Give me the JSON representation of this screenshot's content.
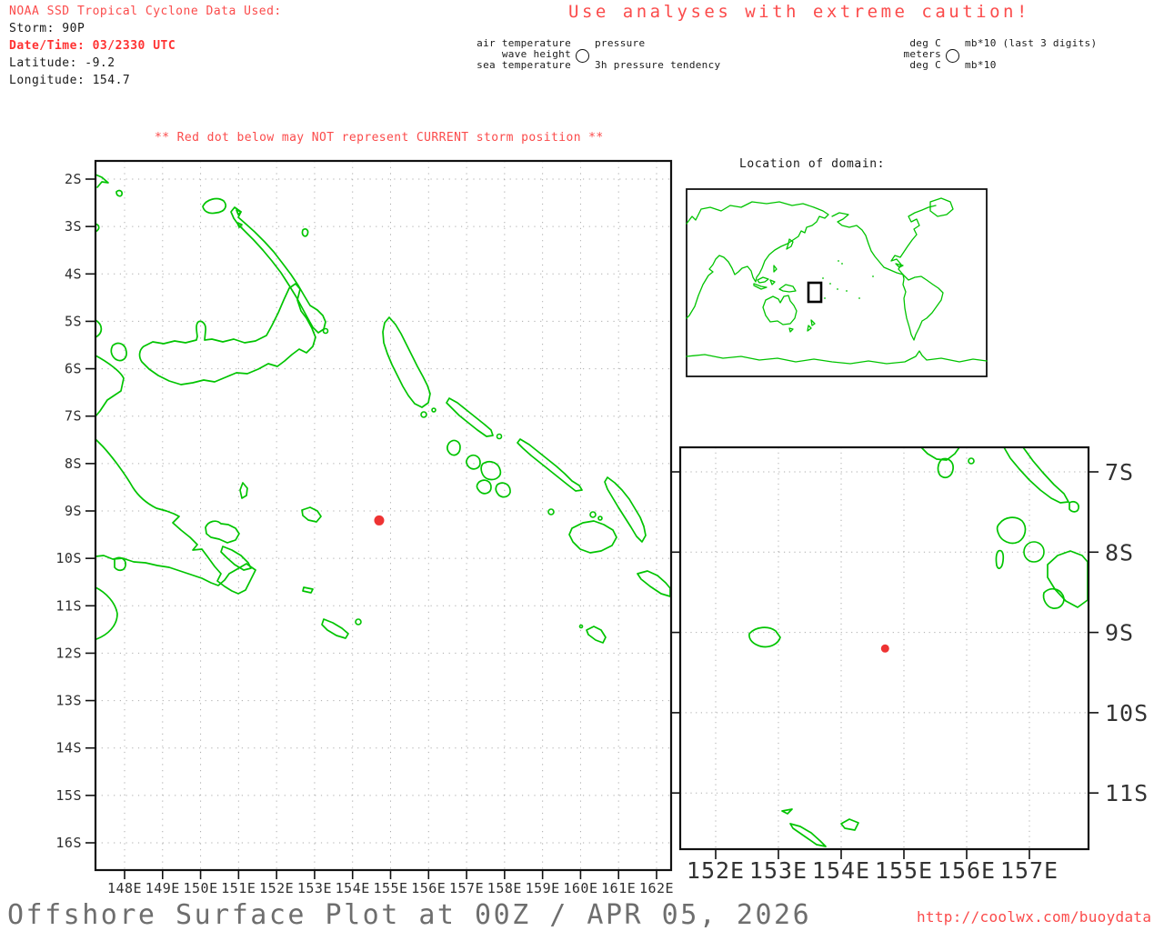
{
  "header": {
    "source_line": "NOAA SSD Tropical Cyclone Data Used:",
    "storm_line": "Storm: 90P",
    "datetime_line": "Date/Time: 03/2330 UTC",
    "latitude_line": "Latitude: -9.2",
    "longitude_line": "Longitude: 154.7",
    "caution": "Use analyses with extreme caution!"
  },
  "station_legend": {
    "param_left": [
      "air temperature",
      "wave height",
      "sea temperature"
    ],
    "param_right_top": "pressure",
    "param_right_bottom": "3h pressure tendency",
    "unit_left": [
      "deg C",
      "meters",
      "deg C"
    ],
    "unit_right_top": "mb*10 (last 3 digits)",
    "unit_right_bottom": "mb*10",
    "circle_icon": "station-circle"
  },
  "warning": "** Red dot below may NOT represent CURRENT storm position **",
  "main_map": {
    "lon_labels": [
      "148E",
      "149E",
      "150E",
      "151E",
      "152E",
      "153E",
      "154E",
      "155E",
      "156E",
      "157E",
      "158E",
      "159E",
      "160E",
      "161E",
      "162E"
    ],
    "lat_labels": [
      "2S",
      "3S",
      "4S",
      "5S",
      "6S",
      "7S",
      "8S",
      "9S",
      "10S",
      "11S",
      "12S",
      "13S",
      "14S",
      "15S",
      "16S"
    ]
  },
  "inset": {
    "title": "Location of domain:"
  },
  "zoom_map": {
    "lon_labels": [
      "152E",
      "153E",
      "154E",
      "155E",
      "156E",
      "157E"
    ],
    "lat_labels": [
      "7S",
      "8S",
      "9S",
      "10S",
      "11S"
    ]
  },
  "storm": {
    "latitude_s": 9.2,
    "longitude_e": 154.7
  },
  "footer": {
    "title": "Offshore Surface Plot at 00Z / APR 05, 2026",
    "url": "http://coolwx.com/buoydata"
  },
  "colors": {
    "coastline": "#00c400",
    "storm_dot": "#ee3333",
    "warning_red": "#fb4b4b",
    "datetime_red": "#ff3232",
    "grid": "#ababab",
    "axis_text": "#2e2e2e",
    "title_gray": "#6e6e6e"
  }
}
